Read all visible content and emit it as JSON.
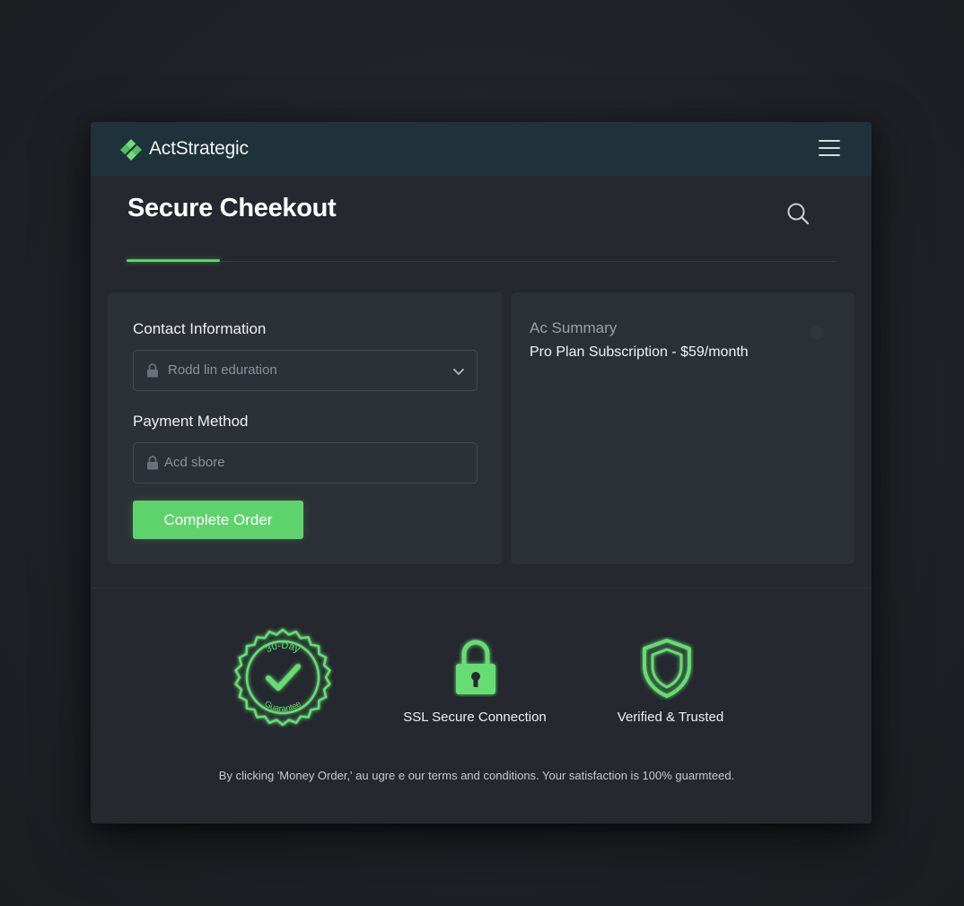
{
  "header": {
    "brand_name": "ActStrategic",
    "logo_icon": "actstrategic-logo-icon",
    "menu_icon": "hamburger-menu-icon"
  },
  "page": {
    "title": "Secure Cheekout",
    "search_icon": "search-icon"
  },
  "contact": {
    "label": "Contact Information",
    "field_value": "Rodd lin eduration",
    "field_icon": "lock-icon",
    "dropdown_icon": "chevron-down-icon"
  },
  "payment": {
    "label": "Payment Method",
    "field_value": "Acd sbore",
    "field_icon": "lock-icon"
  },
  "actions": {
    "complete_order_label": "Complete Order"
  },
  "summary": {
    "title": "Ac Summary",
    "item": "Pro Plan Subscription - $59/month"
  },
  "trust_badges": {
    "guarantee_top": "30-Day",
    "guarantee_bottom": "Guarantee",
    "ssl_label": "SSL Secure Connection",
    "verified_label": "Verified & Trusted"
  },
  "footer": {
    "terms": "By clicking 'Money Order,' au ugre e our terms and conditions. Your satisfaction is 100% guarmteed."
  },
  "colors": {
    "accent": "#5fd36b",
    "header_bg": "#1f3239",
    "card_bg": "#2c3037",
    "window_bg": "#25292f"
  }
}
